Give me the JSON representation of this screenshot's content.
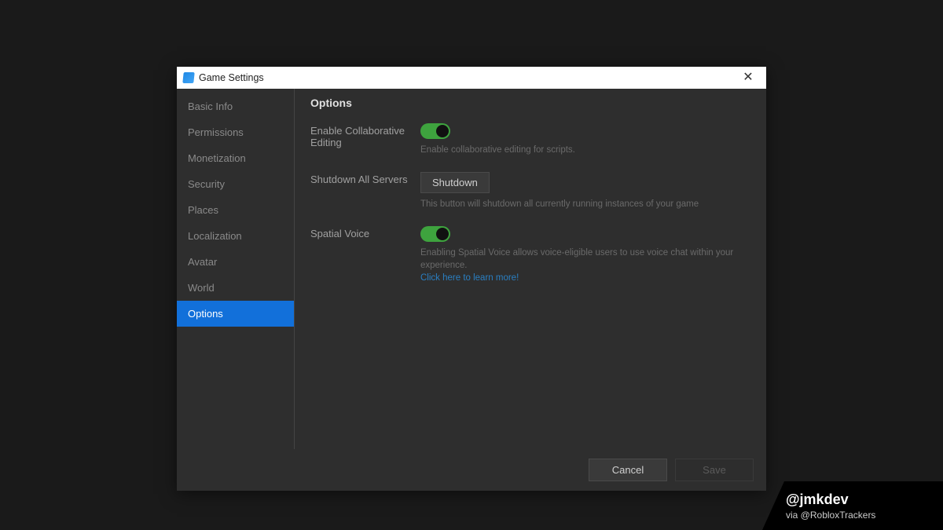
{
  "window": {
    "title": "Game Settings"
  },
  "sidebar": {
    "items": [
      {
        "label": "Basic Info",
        "active": false
      },
      {
        "label": "Permissions",
        "active": false
      },
      {
        "label": "Monetization",
        "active": false
      },
      {
        "label": "Security",
        "active": false
      },
      {
        "label": "Places",
        "active": false
      },
      {
        "label": "Localization",
        "active": false
      },
      {
        "label": "Avatar",
        "active": false
      },
      {
        "label": "World",
        "active": false
      },
      {
        "label": "Options",
        "active": true
      }
    ]
  },
  "content": {
    "section_title": "Options",
    "collab": {
      "label": "Enable Collaborative Editing",
      "helper": "Enable collaborative editing for scripts.",
      "enabled": true
    },
    "shutdown": {
      "label": "Shutdown All Servers",
      "button": "Shutdown",
      "helper": "This button will shutdown all currently running instances of your game"
    },
    "spatial": {
      "label": "Spatial Voice",
      "helper": "Enabling Spatial Voice allows voice-eligible users to use voice chat within your experience.",
      "link": "Click here to learn more!",
      "enabled": true
    }
  },
  "footer": {
    "cancel": "Cancel",
    "save": "Save"
  },
  "watermark": {
    "handle": "@jmkdev",
    "via": "via @RobloxTrackers"
  }
}
